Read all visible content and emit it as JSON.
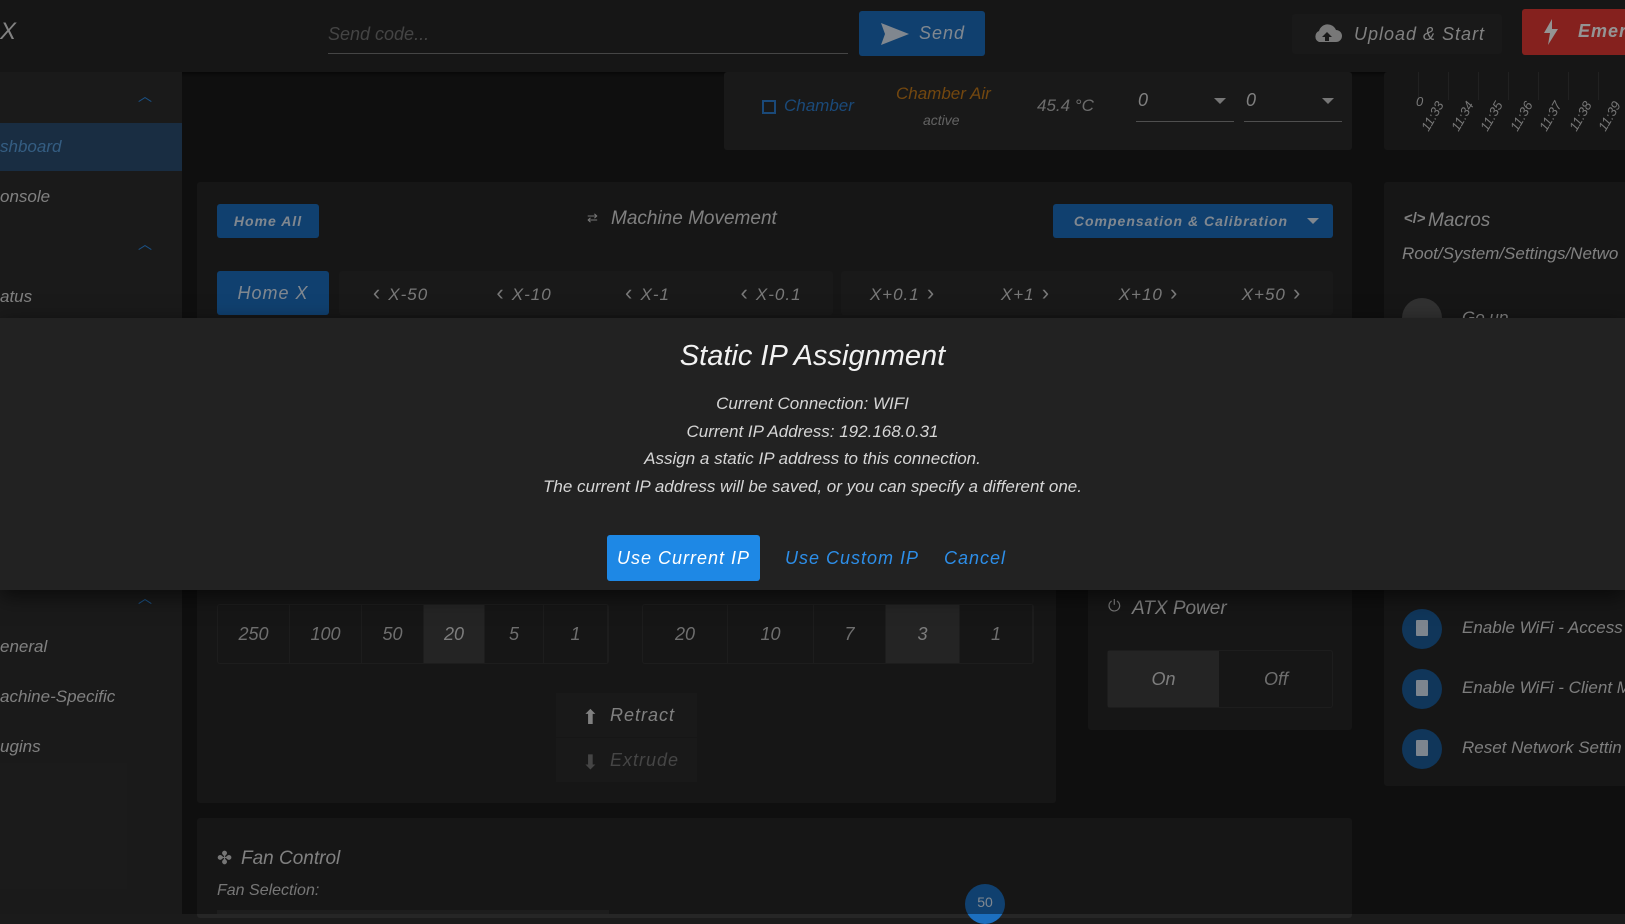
{
  "colors": {
    "accent": "#1c6fbf",
    "emergency": "#e53935",
    "warning": "#c77b1a"
  },
  "topbar": {
    "app_title": "X",
    "code_placeholder": "Send code...",
    "send_label": "Send",
    "upload_label": "Upload & Start",
    "emergency_label": "Emerg"
  },
  "sidebar": {
    "items": [
      {
        "label": "shboard"
      },
      {
        "label": "onsole"
      },
      {
        "label": "atus"
      },
      {
        "label": "eneral"
      },
      {
        "label": "achine-Specific"
      },
      {
        "label": "ugins"
      }
    ]
  },
  "tools": {
    "chamber_label": "Chamber",
    "heater_name": "Chamber Air",
    "heater_state": "active",
    "temperature": "45.4 °C",
    "active_value": "0",
    "standby_value": "0"
  },
  "chart": {
    "y_tick": "0",
    "x_ticks": [
      "11:33",
      "11:34",
      "11:35",
      "11:36",
      "11:37",
      "11:38",
      "11:39"
    ]
  },
  "movement": {
    "home_all": "Home All",
    "title": "Machine Movement",
    "compensation": "Compensation & Calibration",
    "home_x": "Home X",
    "jog": [
      "X-50",
      "X-10",
      "X-1",
      "X-0.1",
      "X+0.1",
      "X+1",
      "X+10",
      "X+50"
    ]
  },
  "macros": {
    "title": "Macros",
    "path": "Root/System/Settings/Netwo",
    "go_up": "Go up",
    "items": [
      "Enable WiFi - Access",
      "Enable WiFi - Client M",
      "Reset Network Settin"
    ]
  },
  "extrude": {
    "feed_amounts": [
      "250",
      "100",
      "50",
      "20",
      "5",
      "1"
    ],
    "feedrates": [
      "20",
      "10",
      "7",
      "3",
      "1"
    ],
    "retract": "Retract",
    "extrude": "Extrude"
  },
  "atx": {
    "title": "ATX Power",
    "on": "On",
    "off": "Off"
  },
  "fan": {
    "title": "Fan Control",
    "selection_label": "Fan Selection:",
    "slider_value": "50"
  },
  "dialog": {
    "title": "Static IP Assignment",
    "line1": "Current Connection: WIFI",
    "line2": "Current IP Address: 192.168.0.31",
    "line3": "Assign a static IP address to this connection.",
    "line4": "The current IP address will be saved, or you can specify a different one.",
    "use_current": "Use Current IP",
    "use_custom": "Use Custom IP",
    "cancel": "Cancel"
  }
}
